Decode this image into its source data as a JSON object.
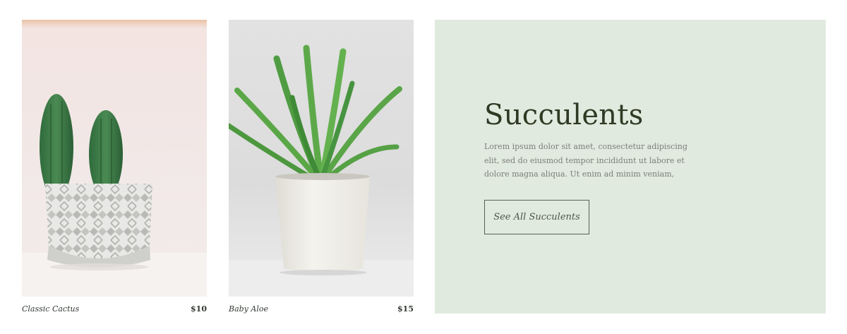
{
  "products": [
    {
      "name": "Classic Cactus",
      "price": "$10",
      "image": "cactus-in-geometric-pot"
    },
    {
      "name": "Baby Aloe",
      "price": "$15",
      "image": "aloe-in-white-pot"
    }
  ],
  "promo": {
    "title": "Succulents",
    "description": "Lorem ipsum dolor sit amet, consectetur adipiscing elit, sed do eiusmod tempor incididunt ut labore et dolore magna aliqua. Ut enim ad minim veniam,",
    "button_label": "See All Succulents"
  },
  "colors": {
    "promo_background": "#e1eadf",
    "title_text": "#2e3a24",
    "button_border": "#566450",
    "body_text": "#7a7f78"
  }
}
